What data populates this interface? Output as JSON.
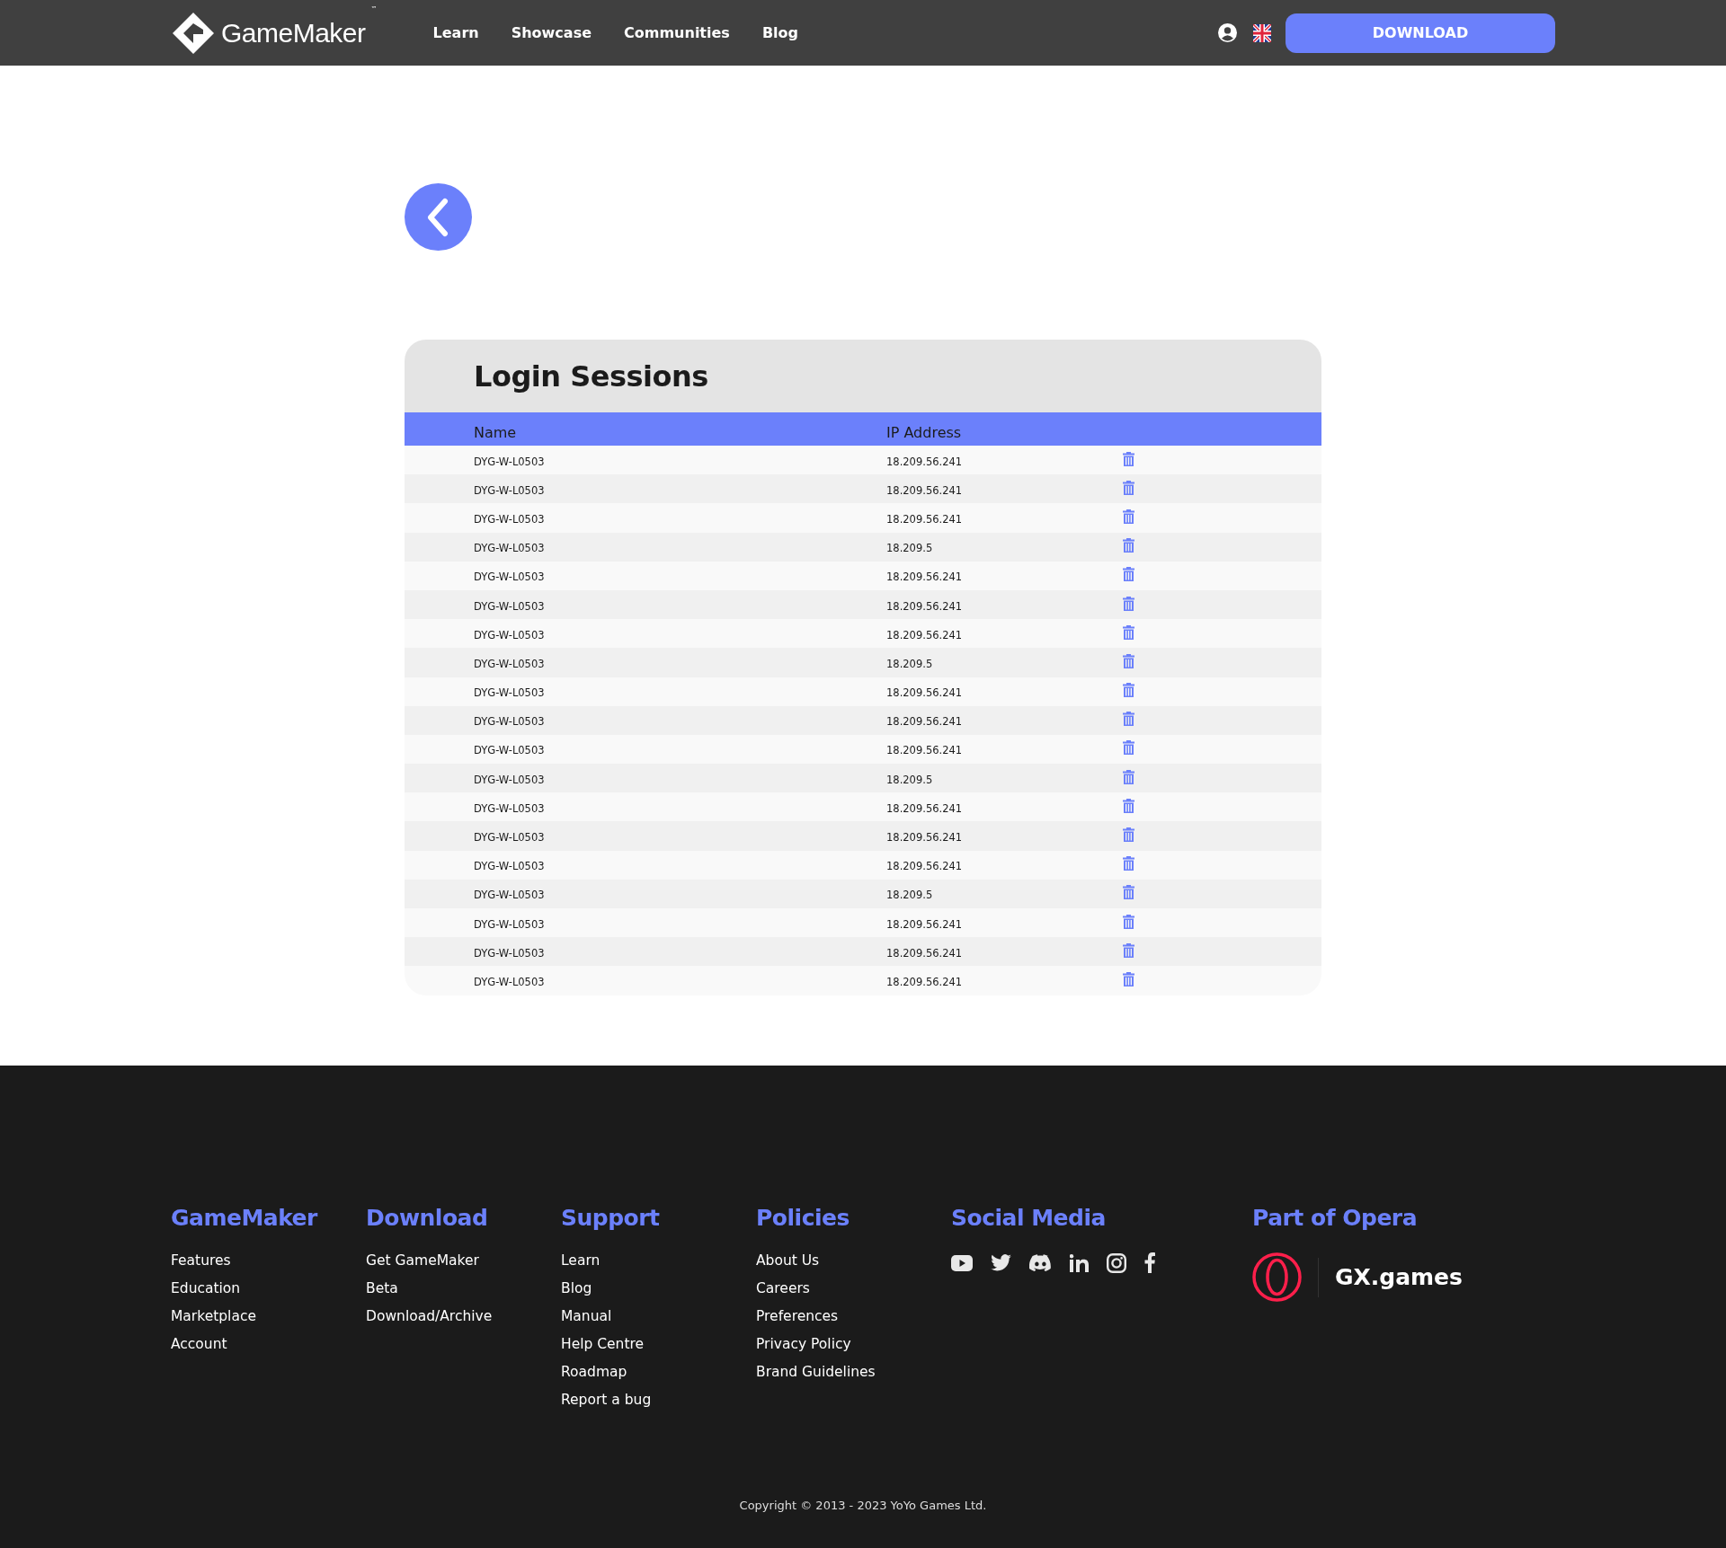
{
  "header": {
    "logo_text": "GameMaker",
    "logo_mark": "™",
    "nav": [
      "Learn",
      "Showcase",
      "Communities",
      "Blog"
    ],
    "download_button": "DOWNLOAD"
  },
  "sessions": {
    "title": "Login Sessions",
    "columns": [
      "Name",
      "IP Address"
    ],
    "rows": [
      {
        "name": "DYG-W-L0503",
        "ip": "18.209.56.241"
      },
      {
        "name": "DYG-W-L0503",
        "ip": "18.209.56.241"
      },
      {
        "name": "DYG-W-L0503",
        "ip": "18.209.56.241"
      },
      {
        "name": "DYG-W-L0503",
        "ip": "18.209.5"
      },
      {
        "name": "DYG-W-L0503",
        "ip": "18.209.56.241"
      },
      {
        "name": "DYG-W-L0503",
        "ip": "18.209.56.241"
      },
      {
        "name": "DYG-W-L0503",
        "ip": "18.209.56.241"
      },
      {
        "name": "DYG-W-L0503",
        "ip": "18.209.5"
      },
      {
        "name": "DYG-W-L0503",
        "ip": "18.209.56.241"
      },
      {
        "name": "DYG-W-L0503",
        "ip": "18.209.56.241"
      },
      {
        "name": "DYG-W-L0503",
        "ip": "18.209.56.241"
      },
      {
        "name": "DYG-W-L0503",
        "ip": "18.209.5"
      },
      {
        "name": "DYG-W-L0503",
        "ip": "18.209.56.241"
      },
      {
        "name": "DYG-W-L0503",
        "ip": "18.209.56.241"
      },
      {
        "name": "DYG-W-L0503",
        "ip": "18.209.56.241"
      },
      {
        "name": "DYG-W-L0503",
        "ip": "18.209.5"
      },
      {
        "name": "DYG-W-L0503",
        "ip": "18.209.56.241"
      },
      {
        "name": "DYG-W-L0503",
        "ip": "18.209.56.241"
      },
      {
        "name": "DYG-W-L0503",
        "ip": "18.209.56.241"
      }
    ]
  },
  "footer": {
    "columns": [
      {
        "heading": "GameMaker",
        "links": [
          "Features",
          "Education",
          "Marketplace",
          "Account"
        ]
      },
      {
        "heading": "Download",
        "links": [
          "Get GameMaker",
          "Beta",
          "Download/Archive"
        ]
      },
      {
        "heading": "Support",
        "links": [
          "Learn",
          "Blog",
          "Manual",
          "Help Centre",
          "Roadmap",
          "Report a bug"
        ]
      },
      {
        "heading": "Policies",
        "links": [
          "About Us",
          "Careers",
          "Preferences",
          "Privacy Policy",
          "Brand Guidelines"
        ]
      }
    ],
    "social_heading": "Social Media",
    "opera_heading": "Part of Opera",
    "gx_text": "GX.games",
    "copyright": "Copyright © 2013 - 2023 YoYo Games Ltd."
  }
}
